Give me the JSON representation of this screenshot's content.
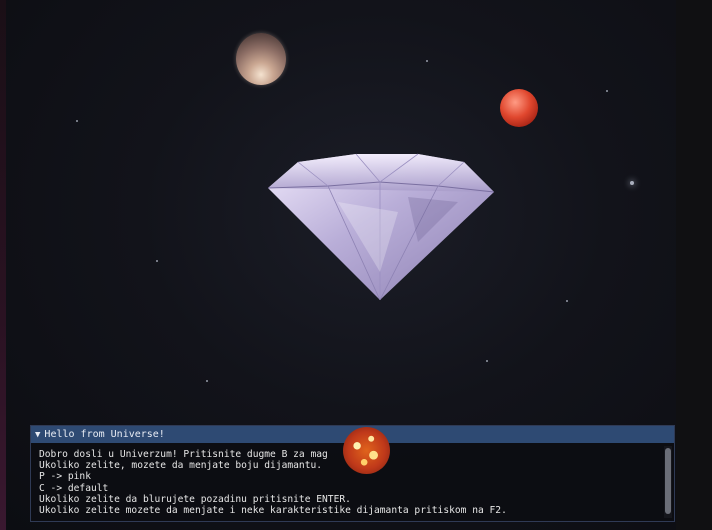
{
  "console": {
    "title": "Hello from Universe!",
    "lines": [
      "Dobro dosli u Univerzum! Pritisnite dugme B za mag",
      "Ukoliko zelite, mozete da menjate boju dijamantu.",
      "P -> pink",
      "C -> default",
      "Ukoliko zelite da blurujete pozadinu pritisnite ENTER.",
      "Ukoliko zelite mozete da menjate i neke karakteristike dijamanta pritiskom na F2."
    ],
    "collapse_icon": "triangle-down-icon"
  },
  "scene": {
    "objects": [
      "moon-planet",
      "red-planet",
      "sun-planet",
      "diamond"
    ]
  },
  "colors": {
    "title_bar": "#2e4a73",
    "console_bg": "#0c0d12",
    "diamond": "#c9bde6"
  }
}
